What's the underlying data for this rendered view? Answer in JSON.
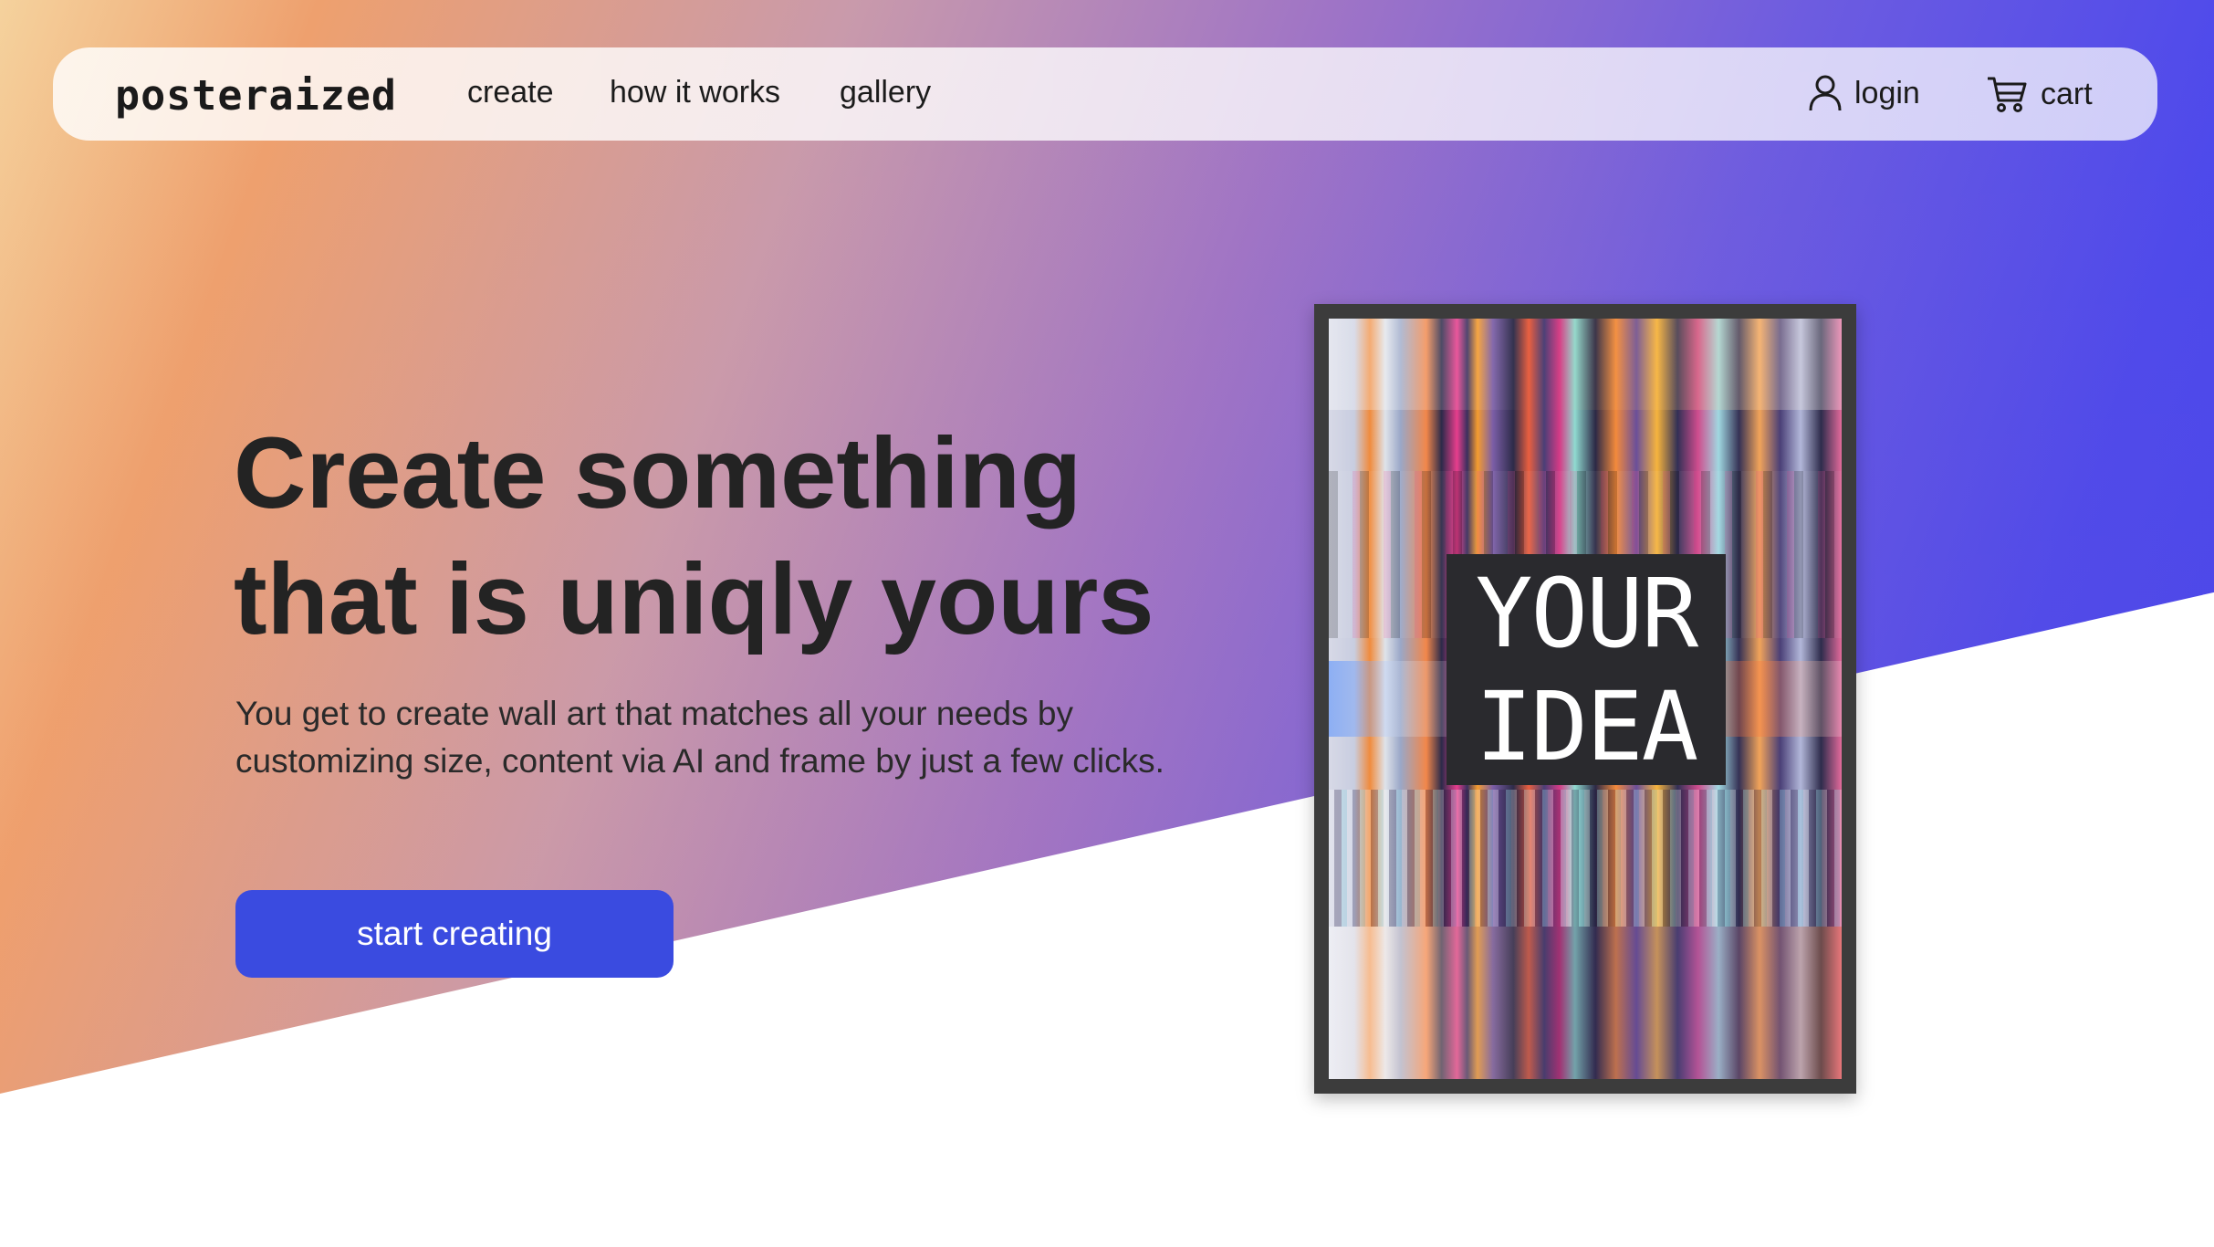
{
  "nav": {
    "logo": "posteraized",
    "links": [
      {
        "label": "create"
      },
      {
        "label": "how it works"
      },
      {
        "label": "gallery"
      }
    ],
    "login_label": "login",
    "cart_label": "cart",
    "login_icon": "user-icon",
    "cart_icon": "cart-icon"
  },
  "hero": {
    "headline_line1": "Create something",
    "headline_line2": "that is uniqly yours",
    "subtext_line1": "You get to create wall art that matches all your needs by",
    "subtext_line2": "customizing size, content via AI and frame by just a few clicks.",
    "cta_label": "start creating"
  },
  "poster": {
    "line1": "YOUR",
    "line2": "IDEA"
  },
  "colors": {
    "accent": "#3a4be0",
    "gradient_start": "#f5d29d",
    "gradient_end": "#4343ee",
    "text_dark": "#232323"
  }
}
